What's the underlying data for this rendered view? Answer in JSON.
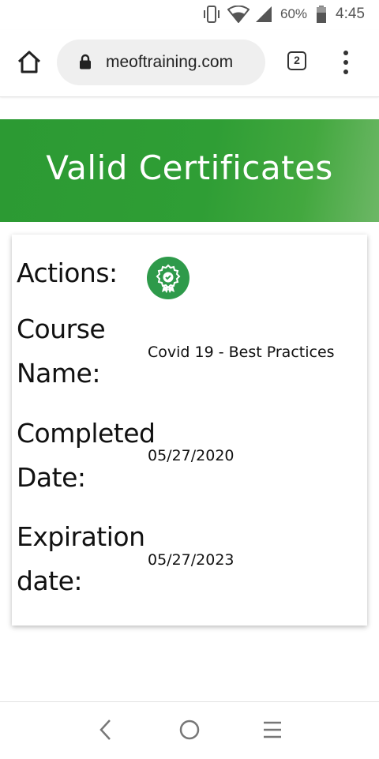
{
  "status_bar": {
    "battery_percent": "60%",
    "time": "4:45",
    "icons": [
      "vibrate-icon",
      "wifi-icon",
      "signal-icon",
      "battery-icon"
    ]
  },
  "browser": {
    "url": "meoftraining.com",
    "tab_count": "2",
    "icons": [
      "home-icon",
      "lock-icon",
      "more-vert-icon"
    ]
  },
  "banner": {
    "title": "Valid Certificates",
    "color": "#2f9e35"
  },
  "certificate": {
    "actions_label": "Actions:",
    "actions_icon": "award-certificate-icon",
    "course_label": "Course Name:",
    "course_name": "Covid 19 - Best Practices",
    "completed_label": "Completed Date:",
    "completed_date": "05/27/2020",
    "expiration_label": "Expiration date:",
    "expiration_date": "05/27/2023"
  },
  "nav_bar": {
    "icons": [
      "back-icon",
      "home-circle-icon",
      "recents-icon"
    ]
  }
}
